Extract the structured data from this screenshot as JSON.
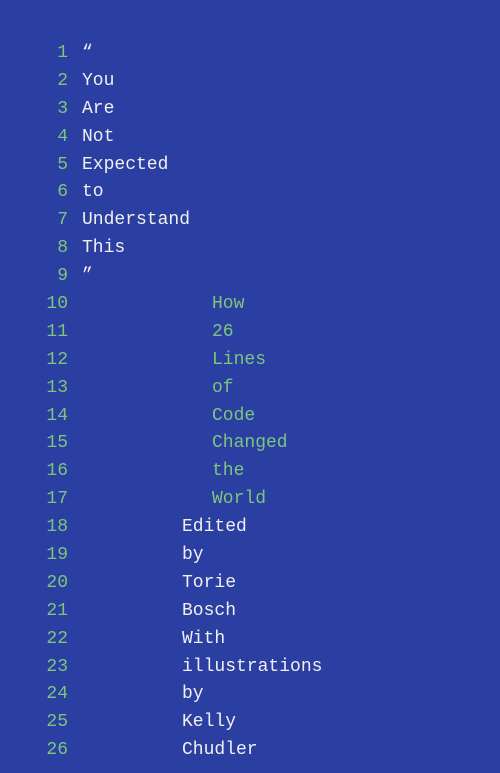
{
  "colors": {
    "background": "#2B3EA1",
    "lineNumbers": "#7BC67E",
    "textWhite": "#F0F0F0",
    "textGreen": "#7BC67E"
  },
  "lines": [
    {
      "num": "1",
      "col": 1,
      "text": "“"
    },
    {
      "num": "2",
      "col": 1,
      "text": "You"
    },
    {
      "num": "3",
      "col": 1,
      "text": "Are"
    },
    {
      "num": "4",
      "col": 1,
      "text": "Not"
    },
    {
      "num": "5",
      "col": 1,
      "text": "Expected"
    },
    {
      "num": "6",
      "col": 1,
      "text": "to"
    },
    {
      "num": "7",
      "col": 1,
      "text": "Understand"
    },
    {
      "num": "8",
      "col": 1,
      "text": "This"
    },
    {
      "num": "9",
      "col": 1,
      "text": "”"
    },
    {
      "num": "10",
      "col": 2,
      "text": "How"
    },
    {
      "num": "11",
      "col": 2,
      "text": "26"
    },
    {
      "num": "12",
      "col": 2,
      "text": "Lines"
    },
    {
      "num": "13",
      "col": 2,
      "text": "of"
    },
    {
      "num": "14",
      "col": 2,
      "text": "Code"
    },
    {
      "num": "15",
      "col": 2,
      "text": "Changed"
    },
    {
      "num": "16",
      "col": 2,
      "text": "the"
    },
    {
      "num": "17",
      "col": 2,
      "text": "World"
    },
    {
      "num": "18",
      "col": 3,
      "text": "Edited"
    },
    {
      "num": "19",
      "col": 3,
      "text": "by"
    },
    {
      "num": "20",
      "col": 3,
      "text": "Torie"
    },
    {
      "num": "21",
      "col": 3,
      "text": "Bosch"
    },
    {
      "num": "22",
      "col": 4,
      "text": "With"
    },
    {
      "num": "23",
      "col": 4,
      "text": "illustrations"
    },
    {
      "num": "24",
      "col": 4,
      "text": "by"
    },
    {
      "num": "25",
      "col": 4,
      "text": "Kelly"
    },
    {
      "num": "26",
      "col": 4,
      "text": "Chudler"
    }
  ]
}
